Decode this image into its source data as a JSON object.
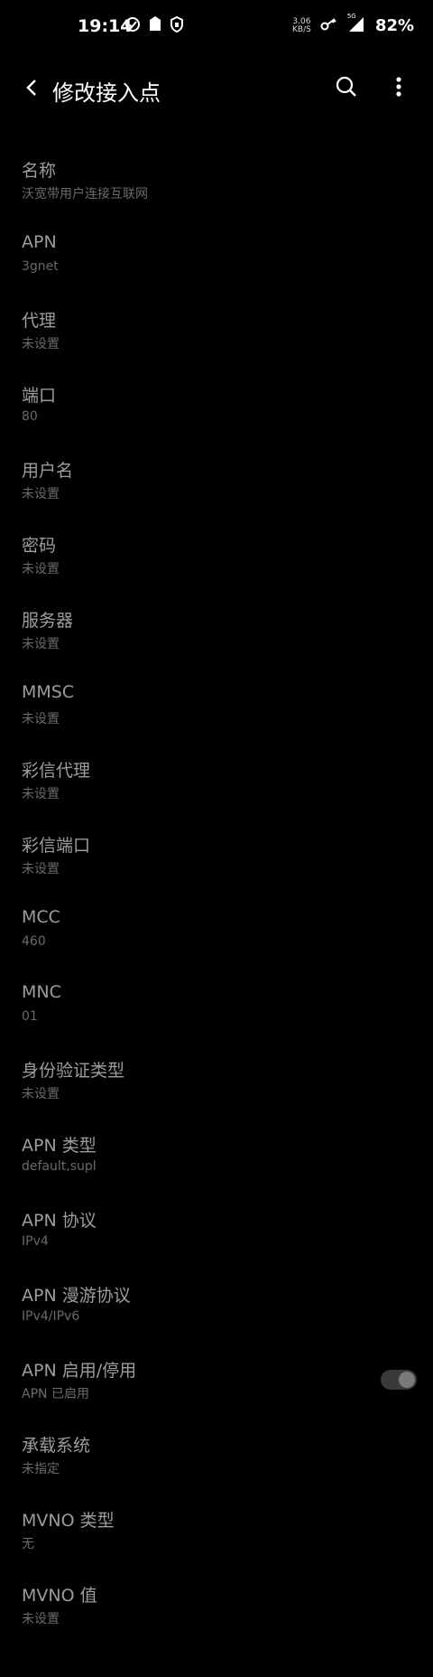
{
  "status_bar": {
    "time": "19:14",
    "speed_top": "3.06",
    "speed_bottom": "KB/S",
    "network": "5G",
    "battery": "82%"
  },
  "app_bar": {
    "title": "修改接入点"
  },
  "fields": [
    {
      "label": "名称",
      "value": "沃宽带用户连接互联网"
    },
    {
      "label": "APN",
      "value": "3gnet"
    },
    {
      "label": "代理",
      "value": "未设置"
    },
    {
      "label": "端口",
      "value": "80"
    },
    {
      "label": "用户名",
      "value": "未设置"
    },
    {
      "label": "密码",
      "value": "未设置"
    },
    {
      "label": "服务器",
      "value": "未设置"
    },
    {
      "label": "MMSC",
      "value": "未设置"
    },
    {
      "label": "彩信代理",
      "value": "未设置"
    },
    {
      "label": "彩信端口",
      "value": "未设置"
    },
    {
      "label": "MCC",
      "value": "460"
    },
    {
      "label": "MNC",
      "value": "01"
    },
    {
      "label": "身份验证类型",
      "value": "未设置"
    },
    {
      "label": "APN 类型",
      "value": "default,supl"
    },
    {
      "label": "APN 协议",
      "value": "IPv4"
    },
    {
      "label": "APN 漫游协议",
      "value": "IPv4/IPv6"
    },
    {
      "label": "APN 启用/停用",
      "value": "APN 已启用",
      "toggle": "on"
    },
    {
      "label": "承载系统",
      "value": "未指定"
    },
    {
      "label": "MVNO 类型",
      "value": "无"
    },
    {
      "label": "MVNO 值",
      "value": "未设置"
    }
  ]
}
